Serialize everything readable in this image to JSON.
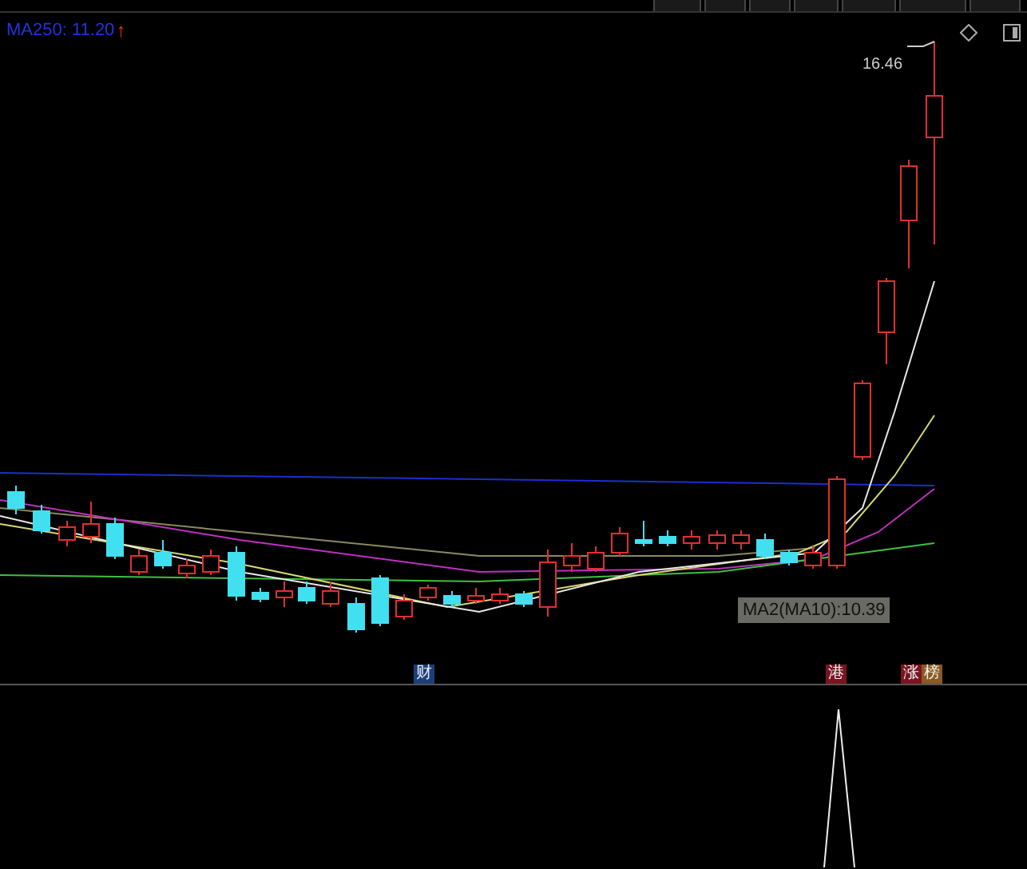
{
  "indicator_label": {
    "text": "MA250: 11.20",
    "arrow": "↑"
  },
  "peak_label": "16.46",
  "tooltip": "MA2(MA10):10.39",
  "event_markers": [
    {
      "label": "财",
      "color": "#1c3f7a"
    },
    {
      "label": "港",
      "color": "#7a1420"
    },
    {
      "label": "涨",
      "color": "#7a1420"
    },
    {
      "label": "榜",
      "color": "#8a5a20"
    }
  ]
}
